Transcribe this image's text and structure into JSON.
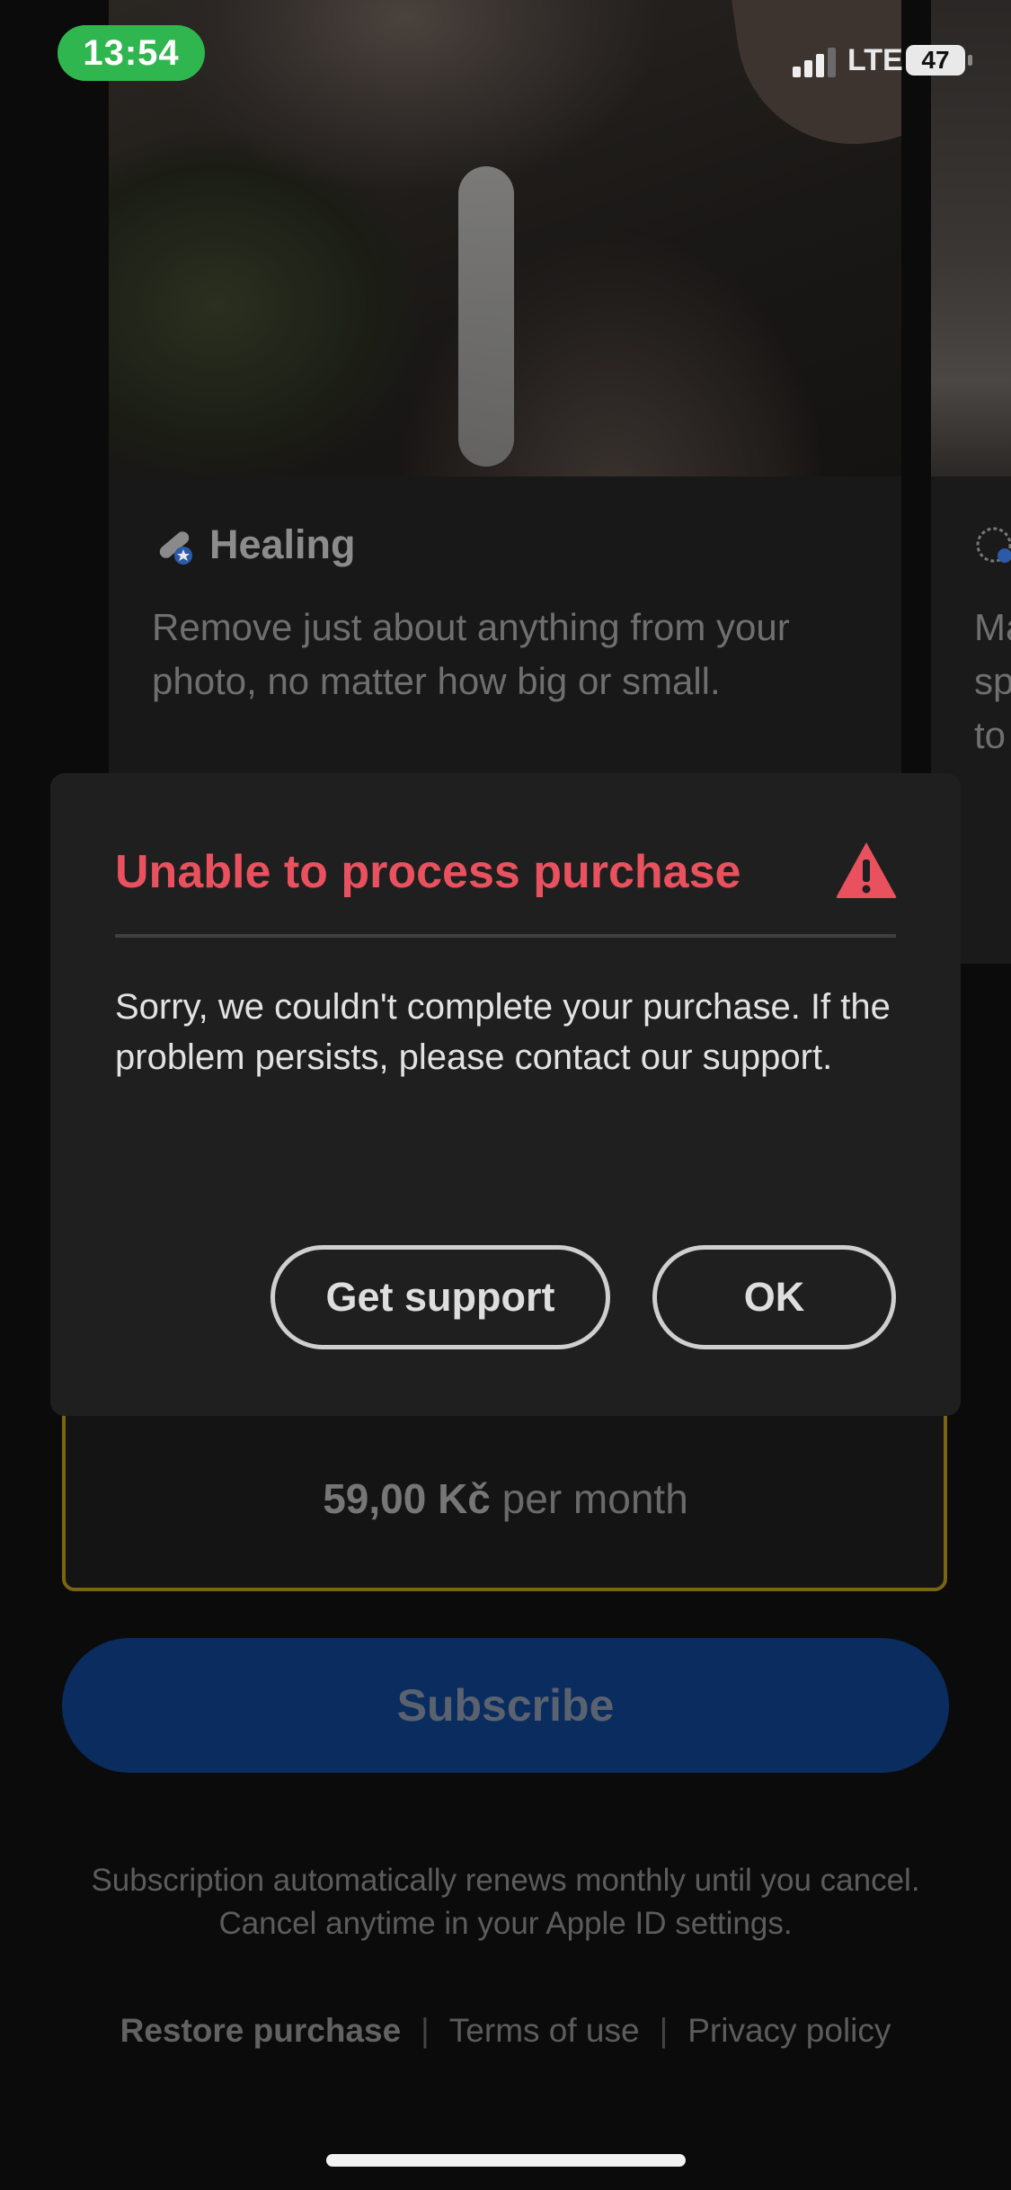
{
  "status_bar": {
    "time": "13:54",
    "network": "LTE",
    "battery": "47",
    "time_pill_color": "#2fb64f"
  },
  "carousel": {
    "current_card": {
      "title": "Healing",
      "description": "Remove just about anything from your photo, no matter how big or small.",
      "icon": "bandage-icon"
    },
    "next_card": {
      "text_fragment": "Ma\nsp\nto",
      "icon": "selection-circle-icon"
    }
  },
  "plan": {
    "price": "59,00 Kč",
    "period": "per month",
    "selected_border_color": "#7a6510"
  },
  "subscribe_button": {
    "label": "Subscribe",
    "color": "#0a2c5e"
  },
  "renew_note": {
    "line1": "Subscription automatically renews monthly until you cancel.",
    "line2": "Cancel anytime in your Apple ID settings."
  },
  "footer": {
    "restore": "Restore purchase",
    "terms": "Terms of use",
    "privacy": "Privacy policy",
    "separator": "|"
  },
  "dialog": {
    "title": "Unable to process purchase",
    "title_color": "#e9515e",
    "icon": "warning-triangle-icon",
    "body": "Sorry, we couldn't complete your purchase. If the problem persists, please contact our support.",
    "support_button": "Get support",
    "ok_button": "OK"
  }
}
